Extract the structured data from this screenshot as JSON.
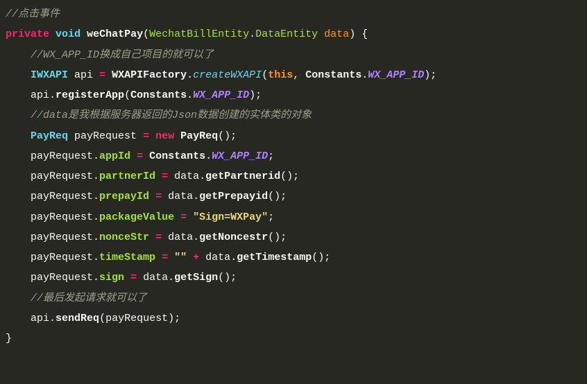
{
  "code": {
    "line1_comment": "//点击事件",
    "kw_private": "private",
    "kw_void": "void",
    "fn_name": "weChatPay",
    "param_type1": "WechatBillEntity",
    "param_type2": "DataEntity",
    "param_name": "data",
    "line3_comment": "//WX_APP_ID换成自己项目的就可以了",
    "type_iwxapi": "IWXAPI",
    "var_api": "api",
    "cls_factory": "WXAPIFactory",
    "m_createWXAPI": "createWXAPI",
    "kw_this": "this",
    "cls_constants": "Constants",
    "const_wxappid": "WX_APP_ID",
    "m_registerApp": "registerApp",
    "line6_comment": "//data是我根据服务器返回的Json数据创建的实体类的对象",
    "type_payreq": "PayReq",
    "var_payreq": "payRequest",
    "kw_new": "new",
    "f_appId": "appId",
    "f_partnerId": "partnerId",
    "m_getPartnerid": "getPartnerid",
    "f_prepayId": "prepayId",
    "m_getPrepayid": "getPrepayid",
    "f_packageValue": "packageValue",
    "str_sign": "\"Sign=WXPay\"",
    "f_nonceStr": "nonceStr",
    "m_getNoncestr": "getNoncestr",
    "f_timeStamp": "timeStamp",
    "str_empty": "\"\"",
    "m_getTimestamp": "getTimestamp",
    "f_sign": "sign",
    "m_getSign": "getSign",
    "line16_comment": "//最后发起请求就可以了",
    "m_sendReq": "sendReq"
  }
}
